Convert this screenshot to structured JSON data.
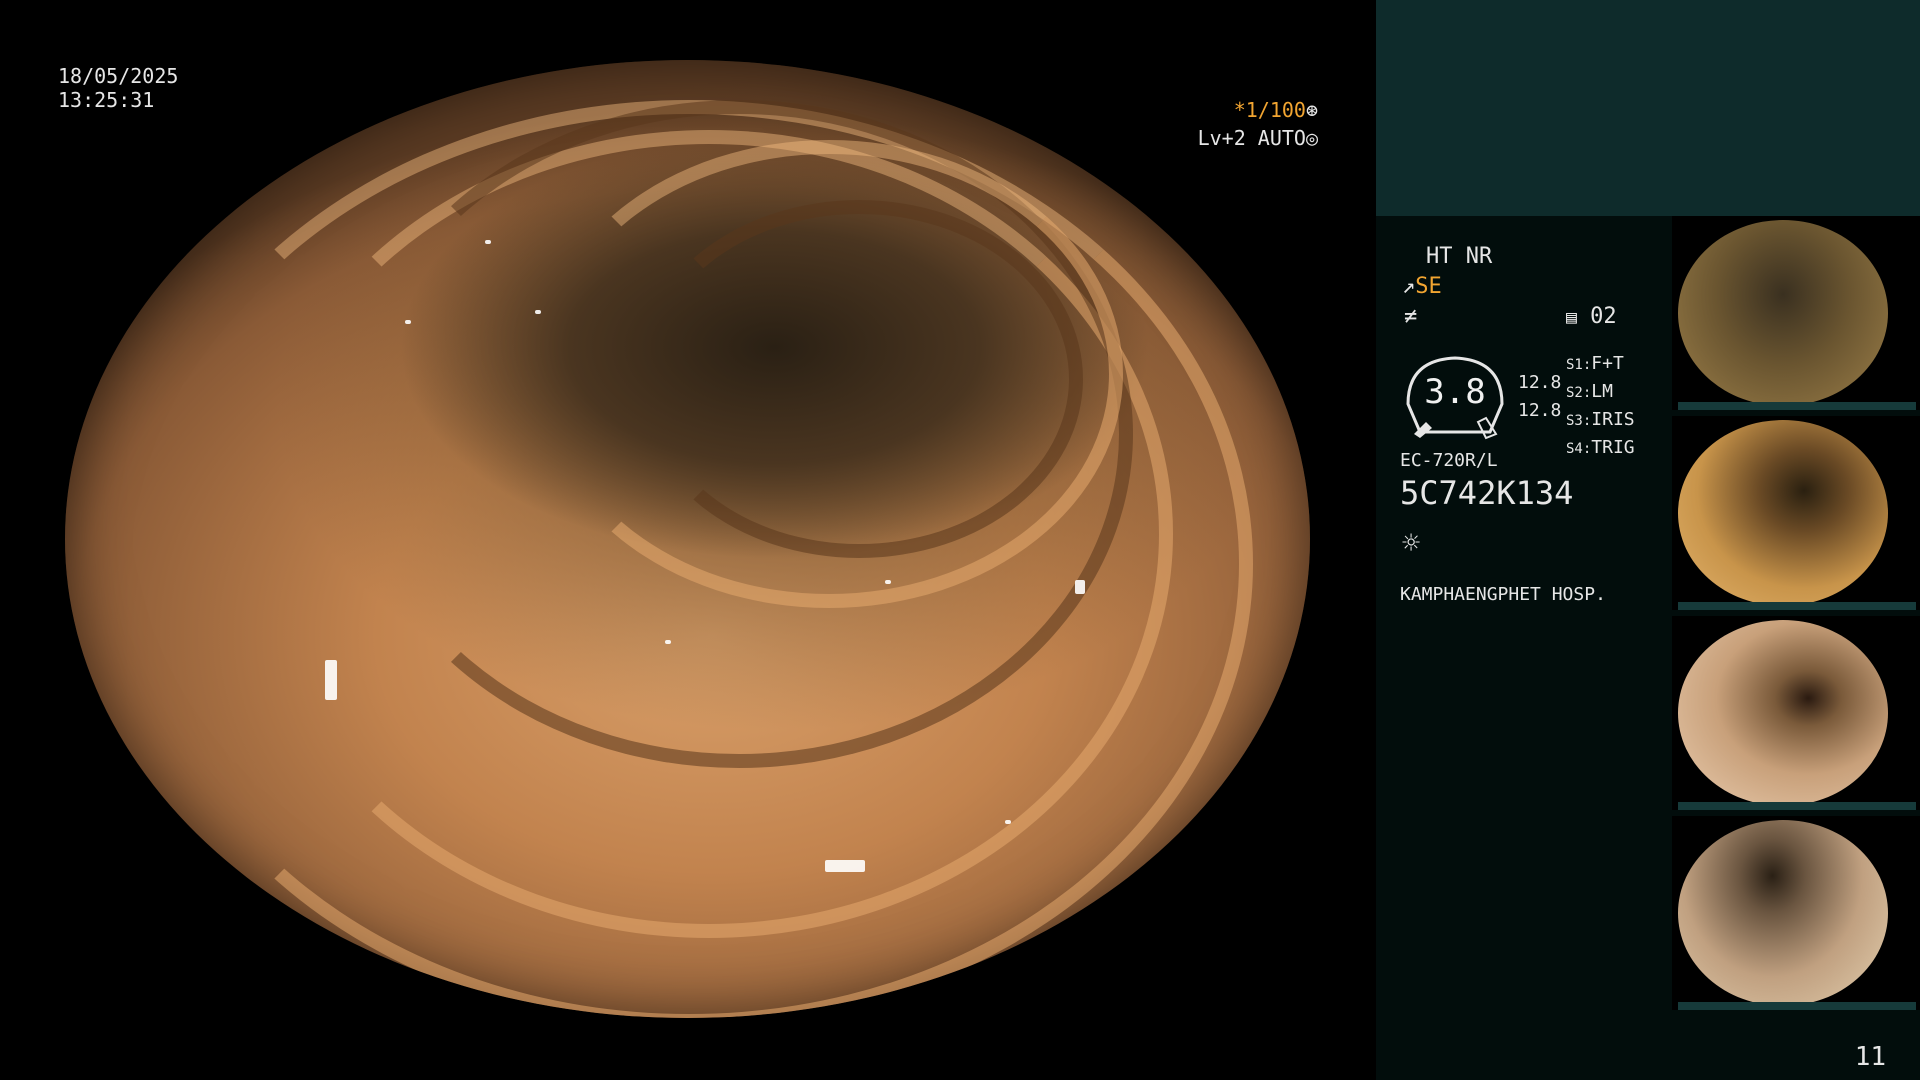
{
  "overlay": {
    "date": "18/05/2025",
    "time": "13:25:31",
    "shutter": "*1/100",
    "shutter_icon": "⊛",
    "level": "Lv+2 AUTO",
    "level_icon": "◎"
  },
  "panel": {
    "mode_line": "HT NR",
    "enhance_icon": "↗",
    "enhance_label": "SE",
    "fn_icon": "≠",
    "memory_icon": "▤",
    "memory_value": "02",
    "gauge_value": "3.8",
    "val_1": "12.8",
    "val_2": "12.8",
    "switches": [
      {
        "key": "S1",
        "value": "F+T"
      },
      {
        "key": "S2",
        "value": "LM"
      },
      {
        "key": "S3",
        "value": "IRIS"
      },
      {
        "key": "S4",
        "value": "TRIG"
      }
    ],
    "scope_model": "EC-720R/L",
    "serial": "5C742K134",
    "light_icon": "☼",
    "hospital": "KAMPHAENGPHET HOSP.",
    "image_count": "11"
  },
  "colors": {
    "accent_orange": "#f2a531",
    "panel_teal": "#0e2b2b",
    "panel_dark": "#020d0c"
  }
}
